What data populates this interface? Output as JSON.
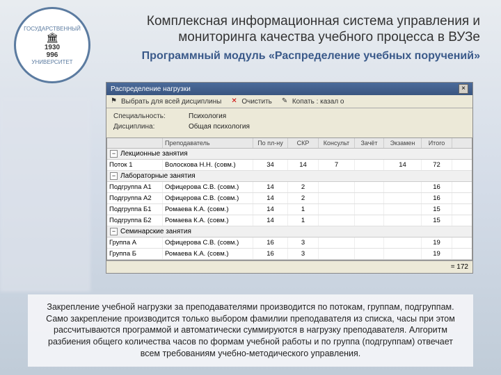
{
  "seal": {
    "year1": "1930",
    "year2": "996",
    "arc": "ГОСУДАРСТВЕННЫЙ",
    "bottom": "УНИВЕРСИТЕТ"
  },
  "header": {
    "title": "Комплексная информационная система управления и мониторинга качества учебного процесса в ВУЗе",
    "subtitle": "Программный модуль «Распределение учебных поручений»"
  },
  "window": {
    "title": "Распределение нагрузки",
    "toolbar": {
      "select": "Выбрать для всей дисциплины",
      "clear": "Очистить",
      "auto": "Копать : казал о"
    },
    "form": {
      "spec_label": "Специальность:",
      "spec_value": "Психология",
      "disc_label": "Дисциплина:",
      "disc_value": "Общая психология"
    },
    "columns": [
      "",
      "Преподаватель",
      "По пл-ну",
      "СКР",
      "Консульт",
      "Зачёт",
      "Экзамен",
      "Итого"
    ],
    "sections": [
      {
        "name": "Лекционные занятия",
        "rows": [
          {
            "c": [
              "Поток 1",
              "Волоскова Н.Н. (совм.)",
              "34",
              "14",
              "7",
              "",
              "14",
              "72"
            ]
          }
        ]
      },
      {
        "name": "Лабораторные занятия",
        "rows": [
          {
            "c": [
              "Подгруппа А1",
              "Офицерова С.В. (совм.)",
              "14",
              "2",
              "",
              "",
              "",
              "16"
            ]
          },
          {
            "c": [
              "Подгруппа А2",
              "Офицерова С.В. (совм.)",
              "14",
              "2",
              "",
              "",
              "",
              "16"
            ]
          },
          {
            "c": [
              "Подгруппа Б1",
              "Ромаева К.А. (совм.)",
              "14",
              "1",
              "",
              "",
              "",
              "15"
            ]
          },
          {
            "c": [
              "Подгруппа Б2",
              "Ромаева К.А. (совм.)",
              "14",
              "1",
              "",
              "",
              "",
              "15"
            ]
          }
        ]
      },
      {
        "name": "Семинарские занятия",
        "rows": [
          {
            "c": [
              "Группа А",
              "Офицерова С.В. (совм.)",
              "16",
              "3",
              "",
              "",
              "",
              "19"
            ]
          },
          {
            "c": [
              "Группа Б",
              "Ромаева К.А. (совм.)",
              "16",
              "3",
              "",
              "",
              "",
              "19"
            ]
          }
        ]
      }
    ],
    "total": "= 172"
  },
  "description": "Закрепление учебной нагрузки за преподавателями производится по потокам, группам, подгруппам. Само закрепление производится только выбором фамилии преподавателя из списка, часы при этом рассчитываются программой и автоматически суммируются в нагрузку преподавателя. Алгоритм разбиения общего количества часов по формам учебной работы и по группа (подгруппам) отвечает всем требованиям учебно-методического управления."
}
